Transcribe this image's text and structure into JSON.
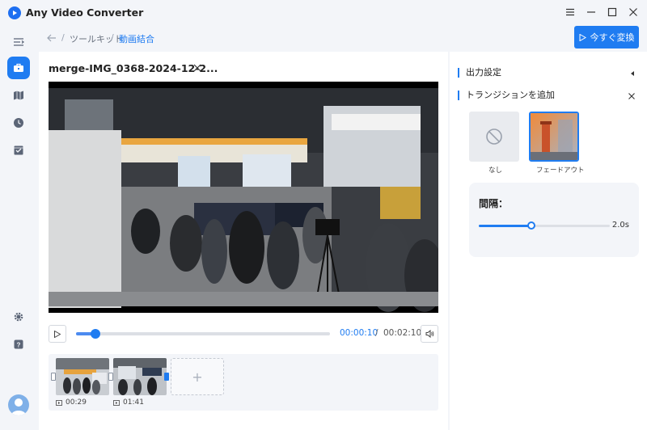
{
  "app": {
    "title": "Any Video Converter"
  },
  "breadcrumb": {
    "items": [
      "ツールキット",
      "動画結合"
    ],
    "separator": "/"
  },
  "toolbar": {
    "convert_label": "今すぐ変換"
  },
  "player": {
    "file_title": "merge-IMG_0368-2024-12-2...",
    "current_time": "00:00:10",
    "time_separator": "/",
    "total_time": "00:02:10",
    "progress_fraction": 0.077
  },
  "clips": [
    {
      "duration": "00:29"
    },
    {
      "duration": "01:41"
    }
  ],
  "right_panel": {
    "output_settings_label": "出力設定",
    "transition_label": "トランジションを追加",
    "transitions": [
      {
        "label": "なし",
        "selected": false
      },
      {
        "label": "フェードアウト",
        "selected": true
      }
    ],
    "interval": {
      "label": "間隔：",
      "value_label": "2.0s",
      "fraction": 0.4
    }
  },
  "colors": {
    "accent": "#1f7cf1",
    "background": "#f3f5f9"
  },
  "icons": [
    "logo-icon",
    "menu-icon",
    "minimize-icon",
    "maximize-icon",
    "close-icon",
    "sidebar-toggle-icon",
    "toolbox-icon",
    "map-icon",
    "clock-icon",
    "checklist-icon",
    "gear-icon",
    "help-icon",
    "back-arrow-icon",
    "play-icon",
    "volume-icon",
    "video-clip-icon",
    "no-entry-icon",
    "collapse-arrow-icon"
  ]
}
